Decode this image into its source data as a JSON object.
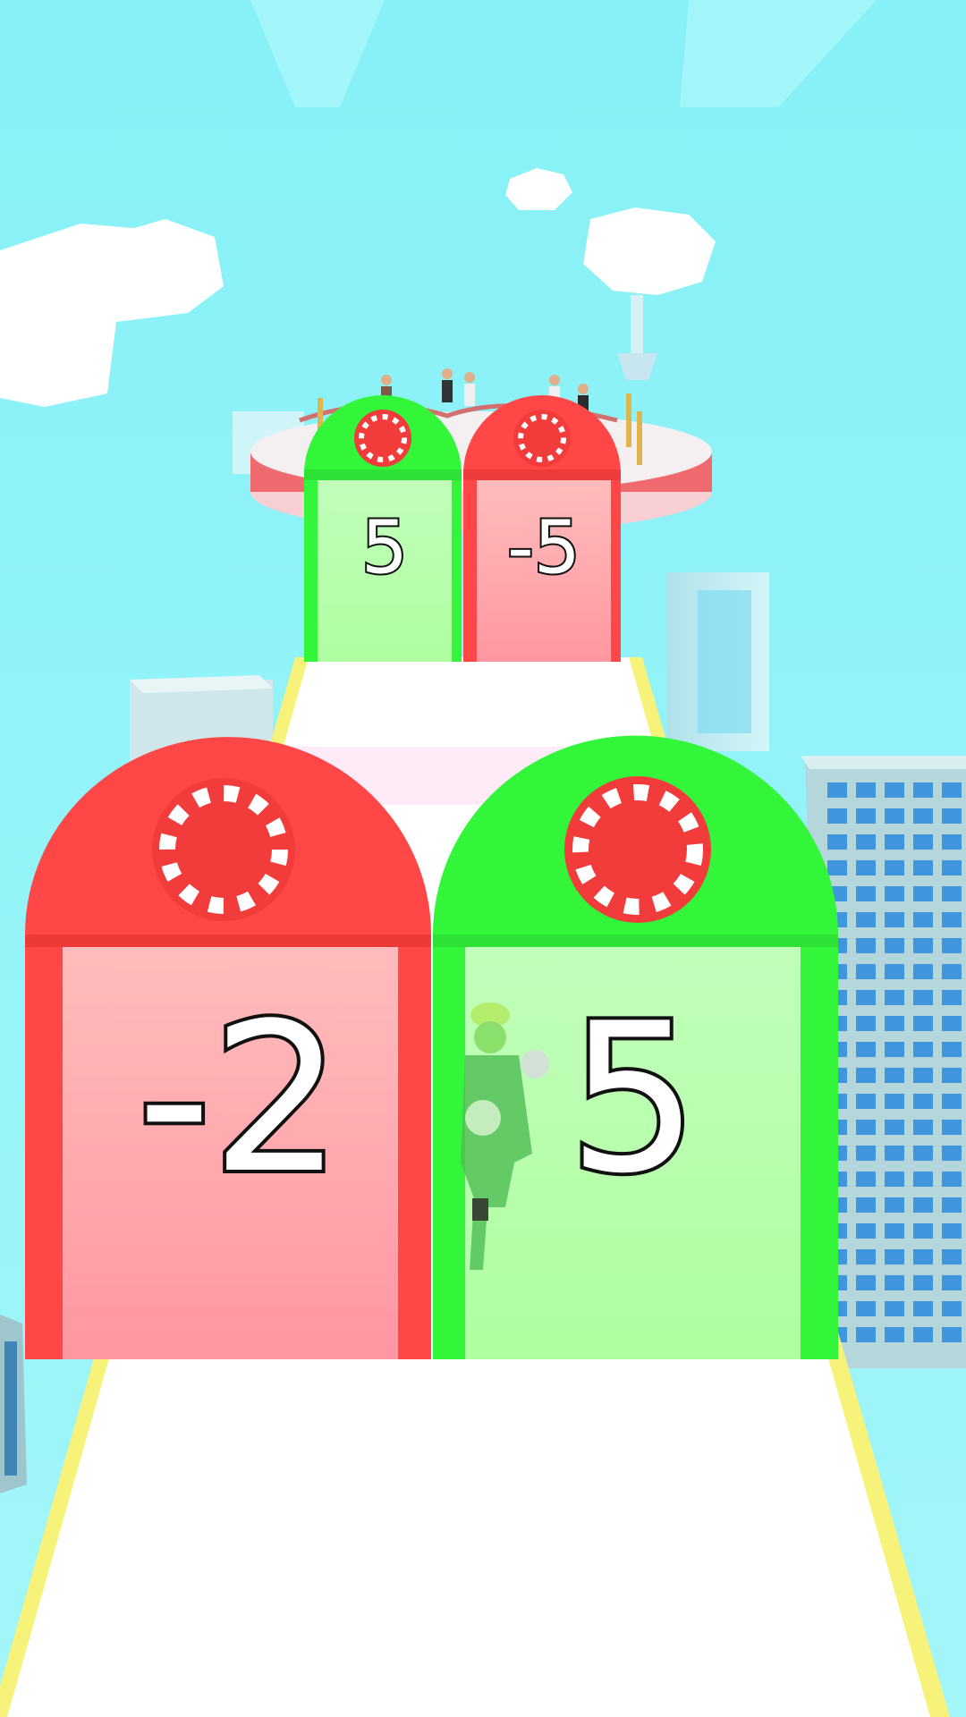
{
  "scene": "runner-level",
  "colors": {
    "sky": "#8ff4f8",
    "track": "#ffffff",
    "track_edge": "#f7f37a",
    "gate_green": "#33f53a",
    "gate_red": "#ff4747",
    "chip_red": "#f23b3b",
    "chip_white": "#ffffff"
  },
  "gates": {
    "far_left": {
      "value": "5",
      "color": "green"
    },
    "far_right": {
      "value": "-5",
      "color": "red"
    },
    "near_left": {
      "value": "-2",
      "color": "red"
    },
    "near_right": {
      "value": "5",
      "color": "green"
    }
  },
  "icons": [
    "poker-chip-icon",
    "player-character-icon",
    "cloud-icon",
    "building-icon"
  ]
}
